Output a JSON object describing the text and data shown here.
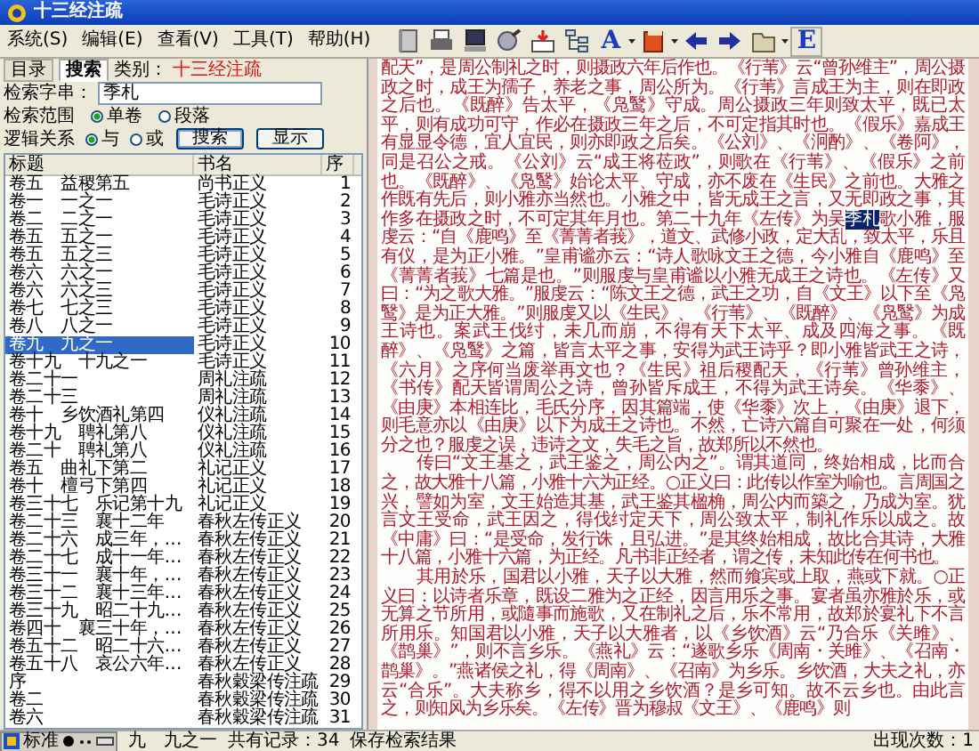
{
  "window": {
    "title": "十三经注疏"
  },
  "menu": [
    "系统(S)",
    "编辑(E)",
    "查看(V)",
    "工具(T)",
    "帮助(H)"
  ],
  "toolbar": [
    {
      "kind": "icon",
      "dropdown": false
    },
    {
      "kind": "icon",
      "dropdown": false
    },
    {
      "kind": "icon",
      "dropdown": false
    },
    {
      "kind": "icon",
      "dropdown": false
    },
    {
      "kind": "icon",
      "dropdown": false
    },
    {
      "kind": "icon",
      "dropdown": false
    },
    {
      "kind": "letter",
      "label": "A",
      "dropdown": true
    },
    {
      "kind": "icon",
      "dropdown": true
    },
    {
      "kind": "icon",
      "dropdown": false
    },
    {
      "kind": "icon",
      "dropdown": false
    },
    {
      "kind": "icon",
      "dropdown": true
    },
    {
      "kind": "letter",
      "label": "E",
      "dropdown": false
    }
  ],
  "tabs": [
    {
      "label": "目录",
      "selected": false
    },
    {
      "label": "搜索",
      "selected": true
    }
  ],
  "search": {
    "category_label": "类别：",
    "category": "十三经注疏",
    "query_label": "检索字串：",
    "query": "季札",
    "scope": {
      "legend": "检索范围",
      "options": [
        {
          "label": "单卷",
          "selected": true
        },
        {
          "label": "段落",
          "selected": false
        }
      ]
    },
    "logic": {
      "legend": "逻辑关系",
      "options": [
        {
          "label": "与",
          "selected": true
        },
        {
          "label": "或",
          "selected": false
        }
      ]
    },
    "buttons": [
      "搜索",
      "显示"
    ]
  },
  "table": {
    "columns": [
      "标题",
      "书名",
      "序"
    ],
    "rows": [
      {
        "title": "卷五　益稷第五",
        "book": "尚书正义",
        "number": "1",
        "selected": false
      },
      {
        "title": "卷一　一之一",
        "book": "毛诗正义",
        "number": "2",
        "selected": false
      },
      {
        "title": "卷二　二之一",
        "book": "毛诗正义",
        "number": "3",
        "selected": false
      },
      {
        "title": "卷五　五之一",
        "book": "毛诗正义",
        "number": "4",
        "selected": false
      },
      {
        "title": "卷五　五之三",
        "book": "毛诗正义",
        "number": "5",
        "selected": false
      },
      {
        "title": "卷六　六之一",
        "book": "毛诗正义",
        "number": "6",
        "selected": false
      },
      {
        "title": "卷六　六之三",
        "book": "毛诗正义",
        "number": "7",
        "selected": false
      },
      {
        "title": "卷七　七之三",
        "book": "毛诗正义",
        "number": "8",
        "selected": false
      },
      {
        "title": "卷八　八之一",
        "book": "毛诗正义",
        "number": "9",
        "selected": false
      },
      {
        "title": "卷九　九之一",
        "book": "毛诗正义",
        "number": "10",
        "selected": true
      },
      {
        "title": "卷十九　十九之一",
        "book": "毛诗正义",
        "number": "11",
        "selected": false
      },
      {
        "title": "卷二十一",
        "book": "周礼注疏",
        "number": "12",
        "selected": false
      },
      {
        "title": "卷二十三",
        "book": "周礼注疏",
        "number": "13",
        "selected": false
      },
      {
        "title": "卷十　乡饮酒礼第四",
        "book": "仪礼注疏",
        "number": "14",
        "selected": false
      },
      {
        "title": "卷十九　聘礼第八",
        "book": "仪礼注疏",
        "number": "15",
        "selected": false
      },
      {
        "title": "卷二十　聘礼第八",
        "book": "仪礼注疏",
        "number": "16",
        "selected": false
      },
      {
        "title": "卷五　曲礼下第二",
        "book": "礼记正义",
        "number": "17",
        "selected": false
      },
      {
        "title": "卷十　檀弓下第四",
        "book": "礼记正义",
        "number": "18",
        "selected": false
      },
      {
        "title": "卷三十七　乐记第十九",
        "book": "礼记正义",
        "number": "19",
        "selected": false
      },
      {
        "title": "卷二十三　襄十二年",
        "book": "春秋左传正义",
        "number": "20",
        "selected": false
      },
      {
        "title": "卷二十六　成三年，…",
        "book": "春秋左传正义",
        "number": "21",
        "selected": false
      },
      {
        "title": "卷二十七　成十一年…",
        "book": "春秋左传正义",
        "number": "22",
        "selected": false
      },
      {
        "title": "卷三十一　襄十年，…",
        "book": "春秋左传正义",
        "number": "23",
        "selected": false
      },
      {
        "title": "卷三十二　襄十三年…",
        "book": "春秋左传正义",
        "number": "24",
        "selected": false
      },
      {
        "title": "卷三十九　昭二十九…",
        "book": "春秋左传正义",
        "number": "25",
        "selected": false
      },
      {
        "title": "卷四十　襄三十年，…",
        "book": "春秋左传正义",
        "number": "26",
        "selected": false
      },
      {
        "title": "卷五十二　昭二十六…",
        "book": "春秋左传正义",
        "number": "27",
        "selected": false
      },
      {
        "title": "卷五十八　哀公六年…",
        "book": "春秋左传正义",
        "number": "28",
        "selected": false
      },
      {
        "title": "序",
        "book": "春秋穀梁传注疏",
        "number": "29",
        "selected": false
      },
      {
        "title": "卷二",
        "book": "春秋穀梁传注疏",
        "number": "30",
        "selected": false
      },
      {
        "title": "卷六",
        "book": "春秋穀梁传注疏",
        "number": "31",
        "selected": false
      }
    ]
  },
  "footer": {
    "count": "共有记录：34",
    "save": "保存检索结果"
  },
  "document": {
    "paragraphs": [
      {
        "indent": false,
        "segments": [
          {
            "text": "配天”，是周公制礼之时，则摄政六年后作也。《行苇》云“曾孙维主”，周公摄政之时，成王为孺子，养老之事，周公所为。《行苇》言成王为主，则在即政之后也。《既醉》告太平，《凫鹥》守成。周公摄政三年则致太平，既已太平，则有成功可守，作必在摄政三年之后，不可定指其时也。《假乐》嘉成王有显显令德，宜人宜民，则亦即政之后矣。《公刘》、《泂酌》、《卷阿》，同是召公之戒。《公刘》云“成王将莅政”，则歌在《行苇》、《假乐》之前也。《既醉》、《凫鹥》始论太平、守成，亦不废在《生民》之前也。大雅之作既有先后，则小雅亦当然也。小雅之中，皆无成王之言，又无即政之事，其作多在摄政之时，不可定其年月也。第二十九年《左传》为吴",
            "highlighted": false
          },
          {
            "text": "季札",
            "highlighted": true
          },
          {
            "text": "歌小雅，服虔云：“自《鹿鸣》至《菁菁者莪》，道文、武修小政，定大乱，致太平，乐且有仪，是为正小雅。”皇甫谧亦云：“诗人歌咏文王之德，今小雅自《鹿鸣》至《菁菁者莪》七篇是也。”则服虔与皇甫谧以小雅无成王之诗也。《左传》又曰：“为之歌大雅。”服虔云：“陈文王之德，武王之功，自《文王》以下至《凫鹥》是为正大雅。”则服虔又以《生民》、《行苇》、《既醉》、《凫鹥》为成王诗也。案武王伐纣，未几而崩，不得有天下太平、成及四海之事。《既醉》、《凫鹥》之篇，皆言太平之事，安得为武王诗乎？即小雅皆武王之诗，《六月》之序何当废举再文也？《生民》祖后稷配天，《行苇》曾孙维主，《书传》配天皆谓周公之诗，曾孙皆斥成王，不得为武王诗矣。《华黍》、《由庚》本相连比，毛氏分序，因其篇端，使《华黍》次上，《由庚》退下，则毛意亦以《由庚》以下为成王之诗也。不然，亡诗六篇自可聚在一处，何须分之也？服虔之误，违诗之文，失毛之旨，故郑所以不然也。",
            "highlighted": false
          }
        ]
      },
      {
        "indent": true,
        "segments": [
          {
            "text": "传曰“文王基之，武王鉴之，周公内之”。谓其道同，终始相成，比而合之，故大雅十八篇，小雅十六为正经。○正义曰：此传以作室为喻也。言周国之兴，譬如为室，文王始造其基，武王鉴其楹桷，周公内而築之，乃成为室。犹言文王受命，武王因之，得伐纣定天下，周公致太平，制礼作乐以成之。故《中庸》曰：“是受命，发行诛，且弘进。”是其终始相成，故比合其诗，大雅十八篇，小雅十六篇，为正经。凡书非正经者，谓之传，未知此传在何书也。",
            "highlighted": false
          }
        ]
      },
      {
        "indent": true,
        "segments": [
          {
            "text": "其用於乐，国君以小雅，天子以大雅，然而飨宾或上取，燕或下就。○正义曰：以诗者乐章，既设二雅为之正经，因言用乐之事。宴者虽亦雅於乐，或无算之节所用，或隨事而施歌，又在制礼之后，乐不常用，故郑於宴礼下不言所用乐。知国君以小雅，天子以大雅者，以《乡饮酒》云“乃合乐《关雎》、《鹊巢》”，则不言乡乐。《燕礼》云：“遂歌乡乐《周南・关雎》、《召南・鹊巢》。”燕诸侯之礼，得《周南》、《召南》为乡乐。乡饮酒，大夫之礼，亦云“合乐”。大夫称乡，得不以用之乡饮酒？是乡可知。故不云乡也。由此言之，则知风为乡乐矣。《左传》晋为穆叔《文王》、《鹿鸣》则",
            "highlighted": false
          }
        ]
      }
    ]
  },
  "status": {
    "ime": "标准",
    "location": "九　九之一",
    "occurrences": "出现次数：1"
  }
}
